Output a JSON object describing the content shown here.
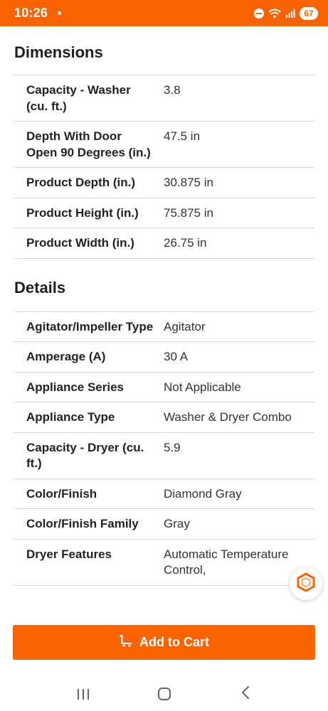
{
  "status_bar": {
    "time": "10:26",
    "battery": "67"
  },
  "dimensions": {
    "title": "Dimensions",
    "rows": [
      {
        "label": "Capacity - Washer (cu. ft.)",
        "value": "3.8"
      },
      {
        "label": "Depth With Door Open 90 Degrees (in.)",
        "value": "47.5 in"
      },
      {
        "label": "Product Depth (in.)",
        "value": "30.875 in"
      },
      {
        "label": "Product Height (in.)",
        "value": "75.875 in"
      },
      {
        "label": "Product Width (in.)",
        "value": "26.75 in"
      }
    ]
  },
  "details": {
    "title": "Details",
    "rows": [
      {
        "label": "Agitator/Impeller Type",
        "value": "Agitator"
      },
      {
        "label": "Amperage (A)",
        "value": "30 A"
      },
      {
        "label": "Appliance Series",
        "value": "Not Applicable"
      },
      {
        "label": "Appliance Type",
        "value": "Washer & Dryer Combo"
      },
      {
        "label": "Capacity - Dryer (cu. ft.)",
        "value": "5.9"
      },
      {
        "label": "Color/Finish",
        "value": "Diamond Gray"
      },
      {
        "label": "Color/Finish Family",
        "value": "Gray"
      },
      {
        "label": "Dryer Features",
        "value": "Automatic Temperature Control,"
      }
    ]
  },
  "cart": {
    "button_label": "Add to Cart"
  },
  "colors": {
    "brand_orange": "#f96302"
  },
  "icons": {
    "status": [
      "do-not-disturb-icon",
      "wifi-icon",
      "signal-icon",
      "battery-icon"
    ],
    "fab": "hexagon-icon",
    "cart": "cart-icon",
    "nav": [
      "recent-apps-icon",
      "home-icon",
      "back-icon"
    ]
  }
}
